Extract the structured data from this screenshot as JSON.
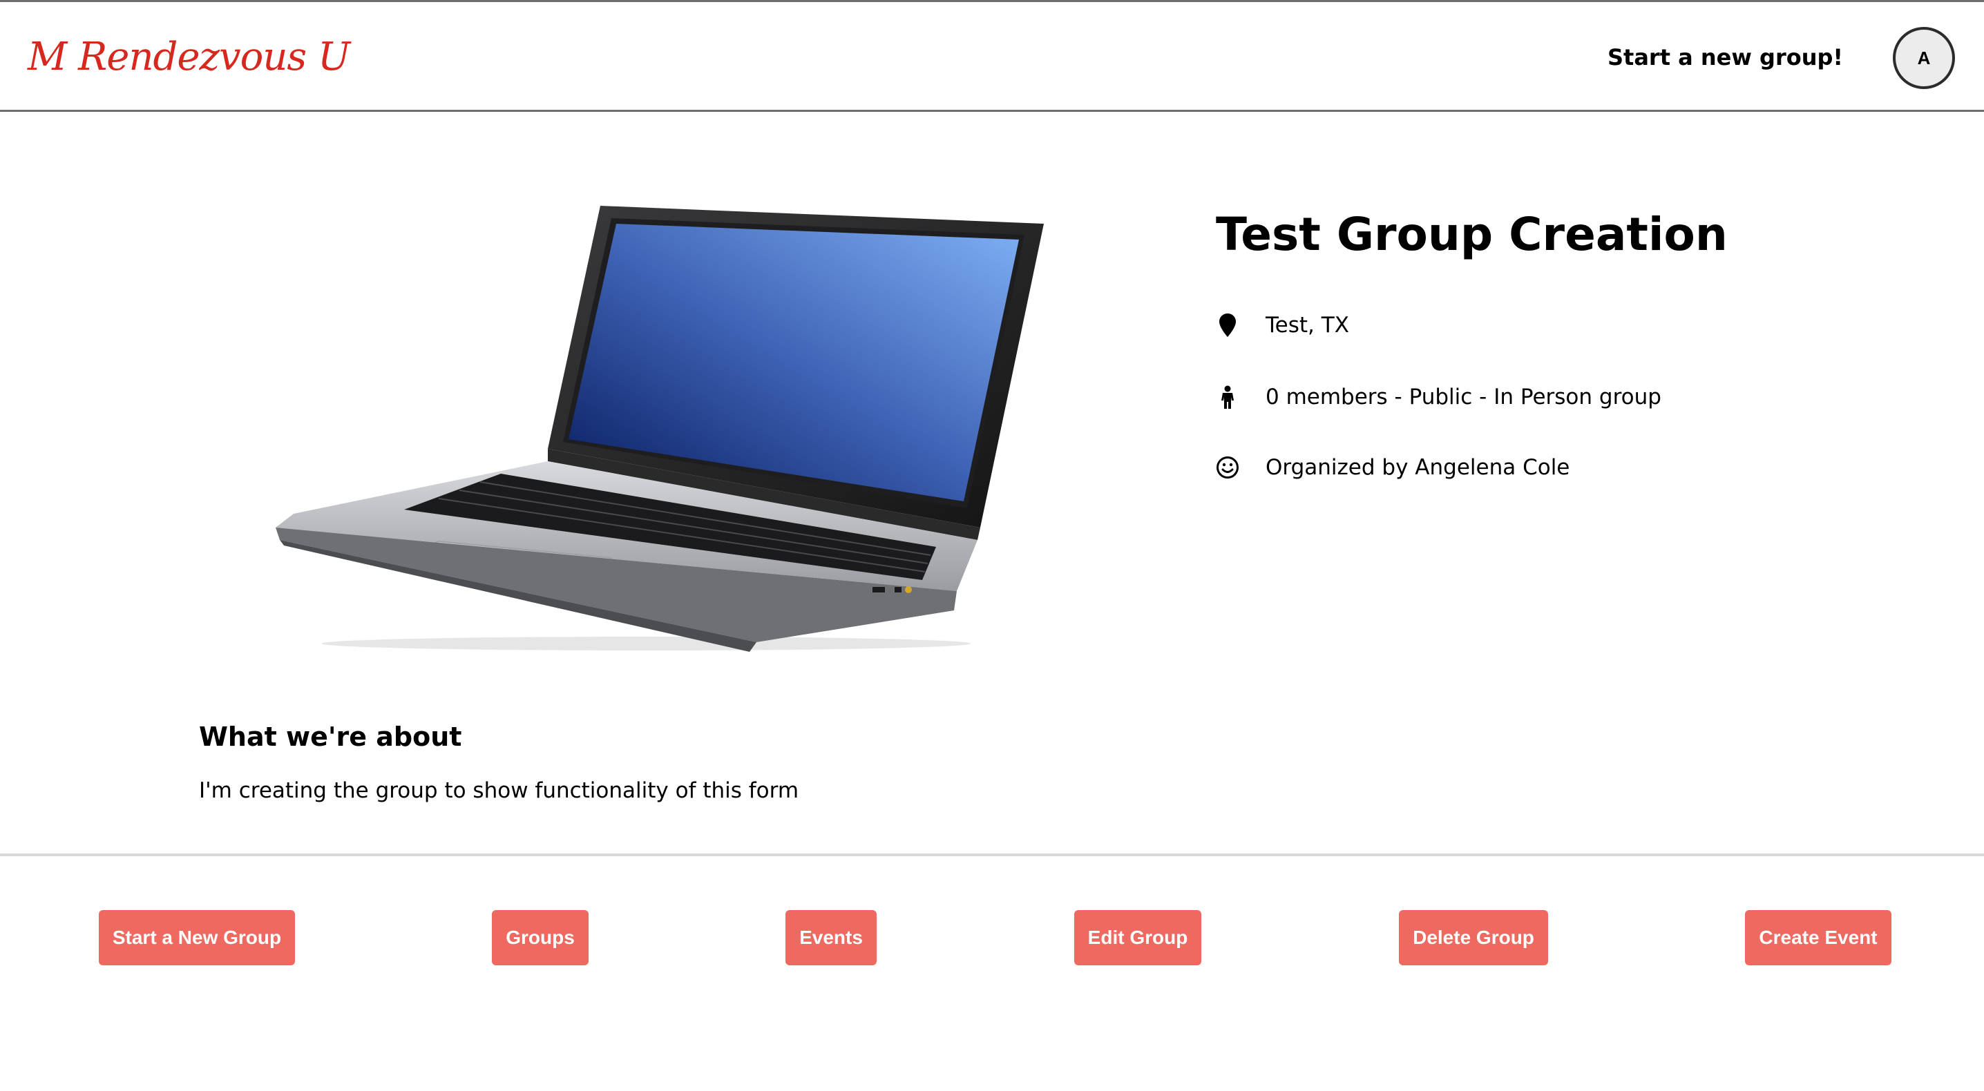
{
  "header": {
    "logo": "M Rendezvous U",
    "start_new_group_link": "Start a new group!",
    "avatar_letter": "A"
  },
  "group": {
    "image_icon": "laptop-image",
    "title": "Test Group Creation",
    "location": "Test, TX",
    "location_icon": "map-pin-icon",
    "members_info": "0 members - Public - In Person group",
    "members_icon": "person-icon",
    "organizer": "Organized by Angelena Cole",
    "organizer_icon": "smiley-icon"
  },
  "about": {
    "heading": "What we're about",
    "text": "I'm creating the group to show functionality of this form"
  },
  "footer_buttons": {
    "start_new_group": "Start a New Group",
    "groups": "Groups",
    "events": "Events",
    "edit_group": "Edit Group",
    "delete_group": "Delete Group",
    "create_event": "Create Event"
  },
  "colors": {
    "logo": "#d6281e",
    "button_bg": "#ee6a60",
    "button_text": "#ffffff",
    "divider": "#d9d9d9"
  }
}
